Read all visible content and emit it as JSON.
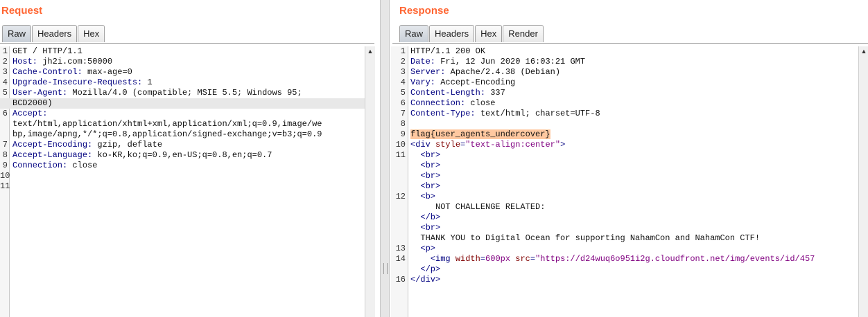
{
  "request": {
    "title": "Request",
    "tabs": [
      "Raw",
      "Headers",
      "Hex"
    ],
    "active_tab": "Raw",
    "lines": [
      {
        "n": "1",
        "text": "GET / HTTP/1.1"
      },
      {
        "n": "2",
        "key": "Host:",
        "val": " jh2i.com:50000"
      },
      {
        "n": "3",
        "key": "Cache-Control:",
        "val": " max-age=0"
      },
      {
        "n": "4",
        "key": "Upgrade-Insecure-Requests:",
        "val": " 1"
      },
      {
        "n": "5",
        "key": "User-Agent:",
        "val": " Mozilla/4.0 (compatible; MSIE 5.5; Windows 95;"
      },
      {
        "n": "",
        "text": "BCD2000)",
        "highlight": true
      },
      {
        "n": "6",
        "key": "Accept:",
        "val": ""
      },
      {
        "n": "",
        "text": "text/html,application/xhtml+xml,application/xml;q=0.9,image/we"
      },
      {
        "n": "",
        "text": "bp,image/apng,*/*;q=0.8,application/signed-exchange;v=b3;q=0.9"
      },
      {
        "n": "7",
        "key": "Accept-Encoding:",
        "val": " gzip, deflate"
      },
      {
        "n": "8",
        "key": "Accept-Language:",
        "val": " ko-KR,ko;q=0.9,en-US;q=0.8,en;q=0.7"
      },
      {
        "n": "9",
        "key": "Connection:",
        "val": " close"
      },
      {
        "n": "10",
        "text": ""
      },
      {
        "n": "11",
        "text": ""
      }
    ]
  },
  "response": {
    "title": "Response",
    "tabs": [
      "Raw",
      "Headers",
      "Hex",
      "Render"
    ],
    "active_tab": "Raw",
    "lines": [
      {
        "n": "1",
        "text": "HTTP/1.1 200 OK"
      },
      {
        "n": "2",
        "key": "Date:",
        "val": " Fri, 12 Jun 2020 16:03:21 GMT"
      },
      {
        "n": "3",
        "key": "Server:",
        "val": " Apache/2.4.38 (Debian)"
      },
      {
        "n": "4",
        "key": "Vary:",
        "val": " Accept-Encoding"
      },
      {
        "n": "5",
        "key": "Content-Length:",
        "val": " 337"
      },
      {
        "n": "6",
        "key": "Connection:",
        "val": " close"
      },
      {
        "n": "7",
        "key": "Content-Type:",
        "val": " text/html; charset=UTF-8"
      },
      {
        "n": "8",
        "text": ""
      },
      {
        "n": "9",
        "flag": "flag{user_agents_undercover}"
      },
      {
        "n": "10",
        "html": [
          [
            "tag",
            "<div "
          ],
          [
            "attr",
            "style"
          ],
          [
            "tag",
            "="
          ],
          [
            "str",
            "\"text-align:center\""
          ],
          [
            "tag",
            ">"
          ]
        ]
      },
      {
        "n": "11",
        "html": [
          [
            "plain",
            "  "
          ],
          [
            "tag",
            "<br>"
          ]
        ]
      },
      {
        "n": "",
        "html": [
          [
            "plain",
            "  "
          ],
          [
            "tag",
            "<br>"
          ]
        ]
      },
      {
        "n": "",
        "html": [
          [
            "plain",
            "  "
          ],
          [
            "tag",
            "<br>"
          ]
        ]
      },
      {
        "n": "",
        "html": [
          [
            "plain",
            "  "
          ],
          [
            "tag",
            "<br>"
          ]
        ]
      },
      {
        "n": "12",
        "html": [
          [
            "plain",
            "  "
          ],
          [
            "tag",
            "<b>"
          ]
        ]
      },
      {
        "n": "",
        "text": "     NOT CHALLENGE RELATED:"
      },
      {
        "n": "",
        "html": [
          [
            "plain",
            "  "
          ],
          [
            "tag",
            "</b>"
          ]
        ]
      },
      {
        "n": "",
        "html": [
          [
            "plain",
            "  "
          ],
          [
            "tag",
            "<br>"
          ]
        ]
      },
      {
        "n": "",
        "text": "  THANK YOU to Digital Ocean for supporting NahamCon and NahamCon CTF!"
      },
      {
        "n": "13",
        "html": [
          [
            "plain",
            "  "
          ],
          [
            "tag",
            "<p>"
          ]
        ]
      },
      {
        "n": "14",
        "html": [
          [
            "plain",
            "    "
          ],
          [
            "tag",
            "<img "
          ],
          [
            "attr",
            "width"
          ],
          [
            "tag",
            "="
          ],
          [
            "str",
            "600px"
          ],
          [
            "plain",
            " "
          ],
          [
            "attr",
            "src"
          ],
          [
            "tag",
            "="
          ],
          [
            "str",
            "\"https://d24wuq6o951i2g.cloudfront.net/img/events/id/457"
          ]
        ]
      },
      {
        "n": "",
        "html": [
          [
            "plain",
            "  "
          ],
          [
            "tag",
            "</p>"
          ]
        ]
      },
      {
        "n": "16",
        "html": [
          [
            "tag",
            "</div>"
          ]
        ]
      }
    ]
  }
}
